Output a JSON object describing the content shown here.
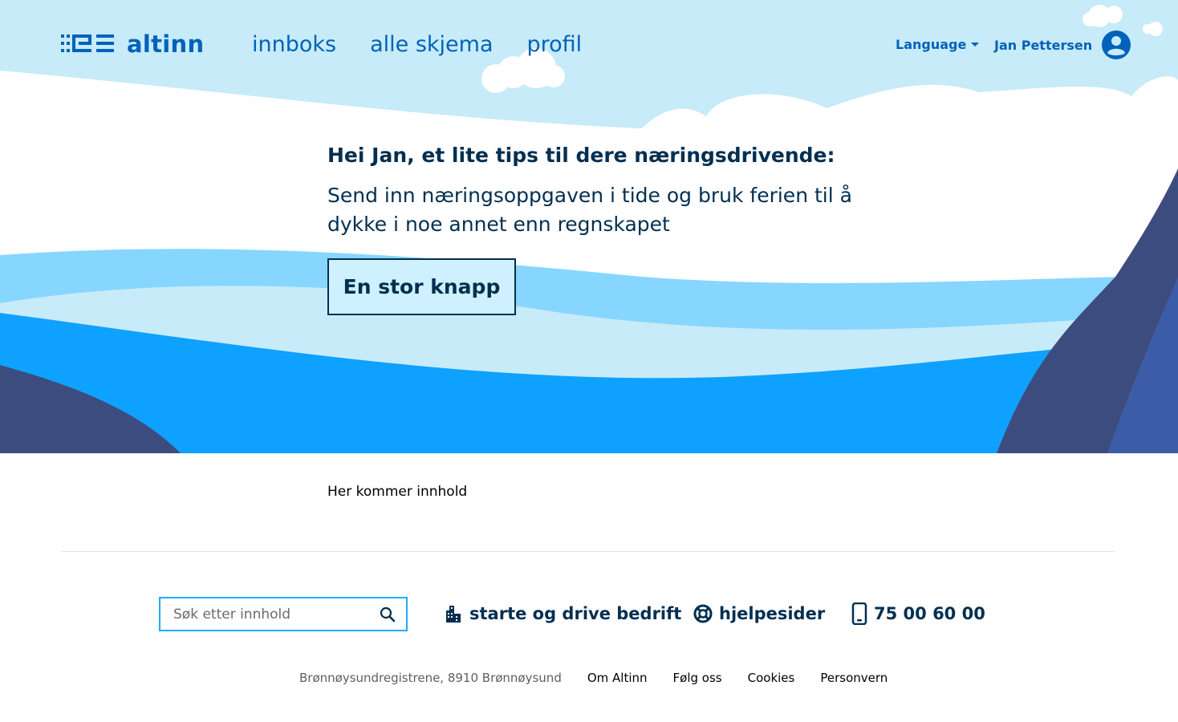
{
  "header": {
    "logo_text": "altinn",
    "nav": [
      "innboks",
      "alle skjema",
      "profil"
    ],
    "language_label": "Language",
    "user_name": "Jan Pettersen"
  },
  "hero": {
    "title": "Hei Jan, et lite tips til dere næringsdrivende:",
    "text": "Send inn næringsoppgaven i tide og bruk ferien til å dykke i noe annet enn regnskapet",
    "button_label": "En stor knapp"
  },
  "content": {
    "text": "Her kommer innhold"
  },
  "footer": {
    "search_placeholder": "Søk etter innhold",
    "links": {
      "business": "starte og drive bedrift",
      "help": "hjelpesider",
      "phone": "75 00 60 00"
    },
    "address": "Brønnøysundregistrene, 8910 Brønnøysund",
    "bottom_links": [
      "Om Altinn",
      "Følg oss",
      "Cookies",
      "Personvern"
    ]
  },
  "colors": {
    "brand_blue": "#0062ba",
    "dark_navy": "#022f51",
    "sky": "#c7ebf8",
    "wave_light": "#87d6ff",
    "wave_mid": "#0fa1ff",
    "mountain": "#3d4c7e",
    "search_border": "#1eaef7"
  },
  "icons": [
    "altinn-logo-icon",
    "caret-down-icon",
    "user-avatar-icon",
    "search-icon",
    "building-icon",
    "lifebuoy-icon",
    "phone-icon"
  ]
}
